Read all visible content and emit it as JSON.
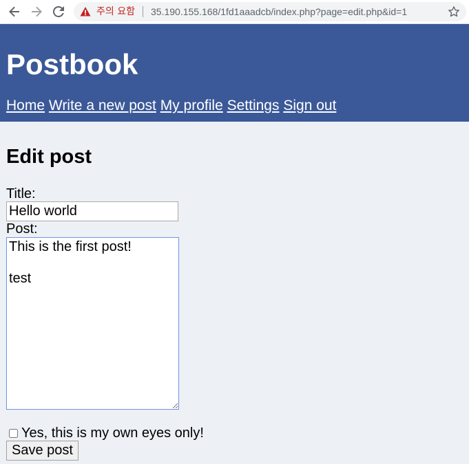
{
  "browser": {
    "warning_text": "주의 요함",
    "url": "35.190.155.168/1fd1aaadcb/index.php?page=edit.php&id=1",
    "icons": {
      "back": "arrow-left-icon",
      "forward": "arrow-right-icon",
      "reload": "reload-icon",
      "warning": "warning-triangle-icon",
      "bookmark": "star-icon"
    },
    "colors": {
      "warning": "#c5221f"
    }
  },
  "site": {
    "title": "Postbook",
    "nav": [
      {
        "label": "Home"
      },
      {
        "label": "Write a new post"
      },
      {
        "label": "My profile"
      },
      {
        "label": "Settings"
      },
      {
        "label": "Sign out"
      }
    ],
    "colors": {
      "header_bg": "#3b5998",
      "page_bg": "#edf0f5"
    }
  },
  "form": {
    "page_title": "Edit post",
    "title_label": "Title:",
    "title_value": "Hello world",
    "post_label": "Post:",
    "post_value": "This is the first post!\n\ntest",
    "private_checkbox_label": "Yes, this is my own eyes only!",
    "private_checked": false,
    "save_label": "Save post"
  }
}
